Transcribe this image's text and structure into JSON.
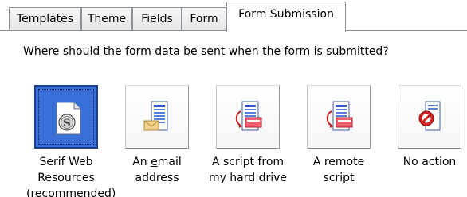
{
  "tabs": [
    {
      "label": "Templates",
      "active": false
    },
    {
      "label": "Theme",
      "active": false
    },
    {
      "label": "Fields",
      "active": false
    },
    {
      "label": "Form",
      "active": false
    },
    {
      "label": "Form Submission",
      "active": true
    }
  ],
  "question": "Where should the form data be sent when the form is submitted?",
  "options": [
    {
      "icon": "serif-web-resources-icon",
      "line1": "Serif Web",
      "line2": "Resources",
      "line3": "(recommended)",
      "selected": true
    },
    {
      "icon": "email-document-icon",
      "line1_pre": "An ",
      "line1_underlined": "e",
      "line1_post": "mail",
      "line2": "address",
      "selected": false
    },
    {
      "icon": "script-document-icon",
      "line1": "A script from",
      "line2": "my hard drive",
      "selected": false
    },
    {
      "icon": "remote-script-icon",
      "line1": "A remote",
      "line2": "script",
      "selected": false
    },
    {
      "icon": "no-action-icon",
      "line1": "No action",
      "selected": false
    }
  ],
  "colors": {
    "selected_tile": "#3a6fd8",
    "tab_border": "#8c9299",
    "no_action_red": "#d42020"
  }
}
